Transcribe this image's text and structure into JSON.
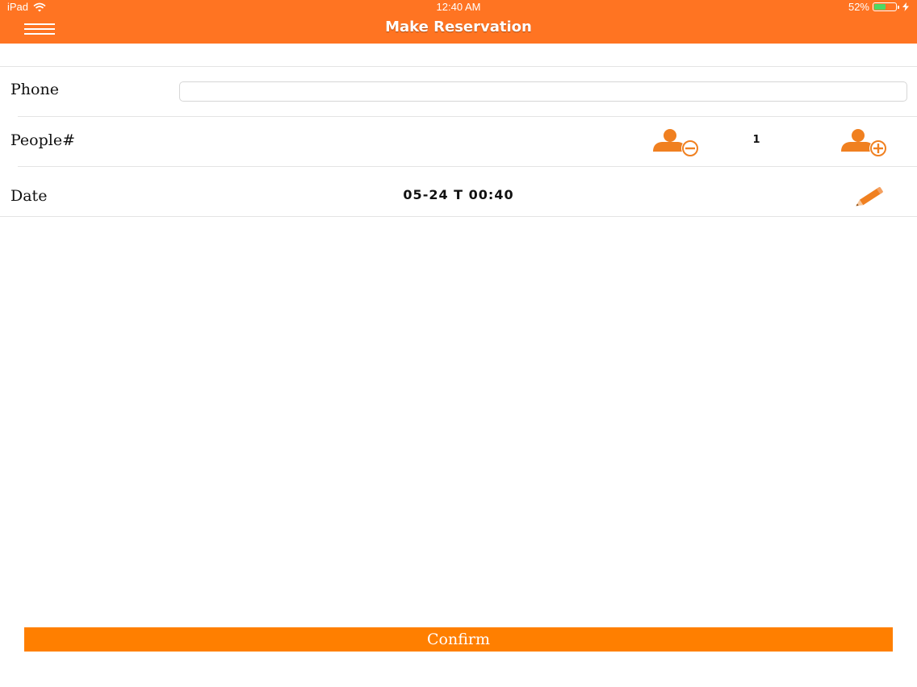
{
  "status_bar": {
    "device": "iPad",
    "time": "12:40 AM",
    "battery_percent": "52%",
    "battery_level": 0.52,
    "battery_color": "#4cd964",
    "icons": [
      "wifi-icon",
      "battery-icon",
      "charging-bolt-icon"
    ]
  },
  "nav": {
    "title": "Make Reservation",
    "menu_icon": "hamburger-menu-icon",
    "background_color": "#ff7422"
  },
  "form": {
    "phone": {
      "label": "Phone",
      "value": "",
      "placeholder": ""
    },
    "people": {
      "label": "People#",
      "count": "1",
      "decrement_icon": "person-minus-icon",
      "increment_icon": "person-plus-icon"
    },
    "date": {
      "label": "Date",
      "value": "05-24 T 00:40",
      "edit_icon": "pencil-icon"
    }
  },
  "confirm": {
    "label": "Confirm",
    "color": "#ff7f00"
  },
  "accent_color": "#f08020"
}
